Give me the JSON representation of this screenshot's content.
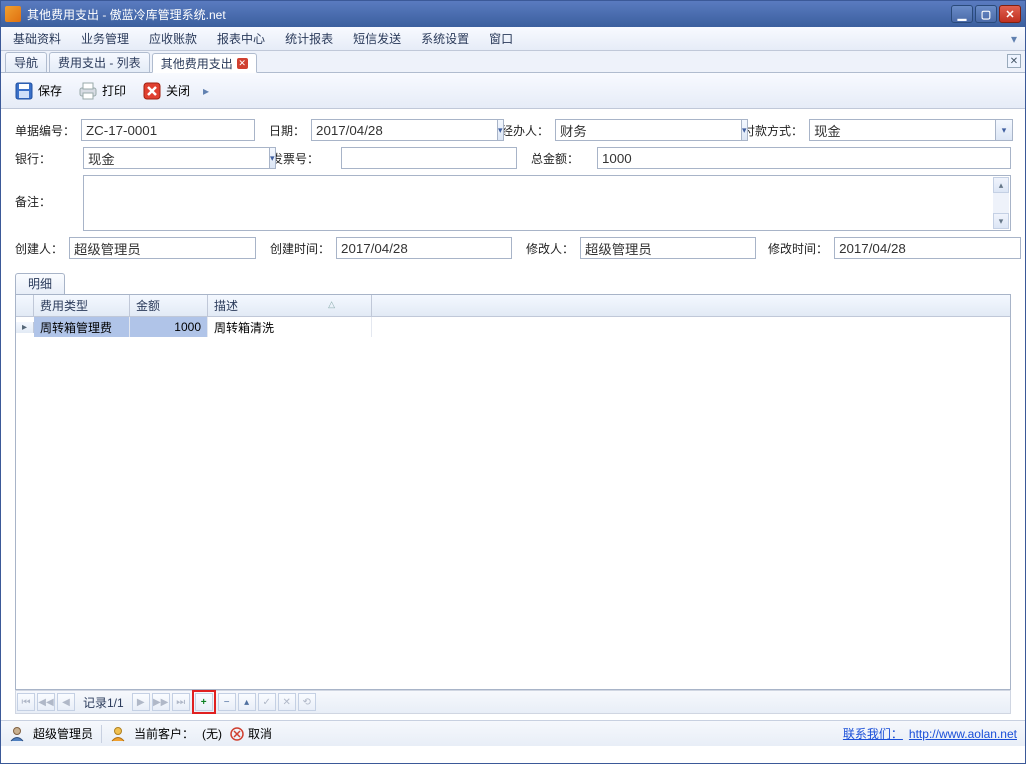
{
  "title": "其他费用支出 - 傲蓝冷库管理系统.net",
  "menus": [
    "基础资料",
    "业务管理",
    "应收账款",
    "报表中心",
    "统计报表",
    "短信发送",
    "系统设置",
    "窗口"
  ],
  "tabs": [
    {
      "label": "导航",
      "closable": false,
      "active": false
    },
    {
      "label": "费用支出 - 列表",
      "closable": false,
      "active": false
    },
    {
      "label": "其他费用支出",
      "closable": true,
      "active": true
    }
  ],
  "toolbar": {
    "save": "保存",
    "print": "打印",
    "close": "关闭"
  },
  "form": {
    "doc_no_label": "单据编号：",
    "doc_no": "ZC-17-0001",
    "date_label": "日期：",
    "date": "2017/04/28",
    "handler_label": "经办人：",
    "handler": "财务",
    "pay_method_label": "付款方式：",
    "pay_method": "现金",
    "bank_label": "银行：",
    "bank": "现金",
    "invoice_label": "发票号：",
    "invoice": "",
    "total_label": "总金额：",
    "total": "1000",
    "remark_label": "备注：",
    "remark": "",
    "creator_label": "创建人：",
    "creator": "超级管理员",
    "ctime_label": "创建时间：",
    "ctime": "2017/04/28",
    "modifier_label": "修改人：",
    "modifier": "超级管理员",
    "mtime_label": "修改时间：",
    "mtime": "2017/04/28"
  },
  "detail": {
    "tab": "明细",
    "columns": {
      "type": "费用类型",
      "amount": "金额",
      "desc": "描述"
    },
    "rows": [
      {
        "type": "周转箱管理费",
        "amount": "1000",
        "desc": "周转箱清洗"
      }
    ]
  },
  "navigator": {
    "record": "记录1/1"
  },
  "status": {
    "user": "超级管理员",
    "client_label": "当前客户：",
    "client_value": "(无)",
    "cancel": "取消",
    "contact_label": "联系我们：",
    "contact_url": "http://www.aolan.net"
  }
}
